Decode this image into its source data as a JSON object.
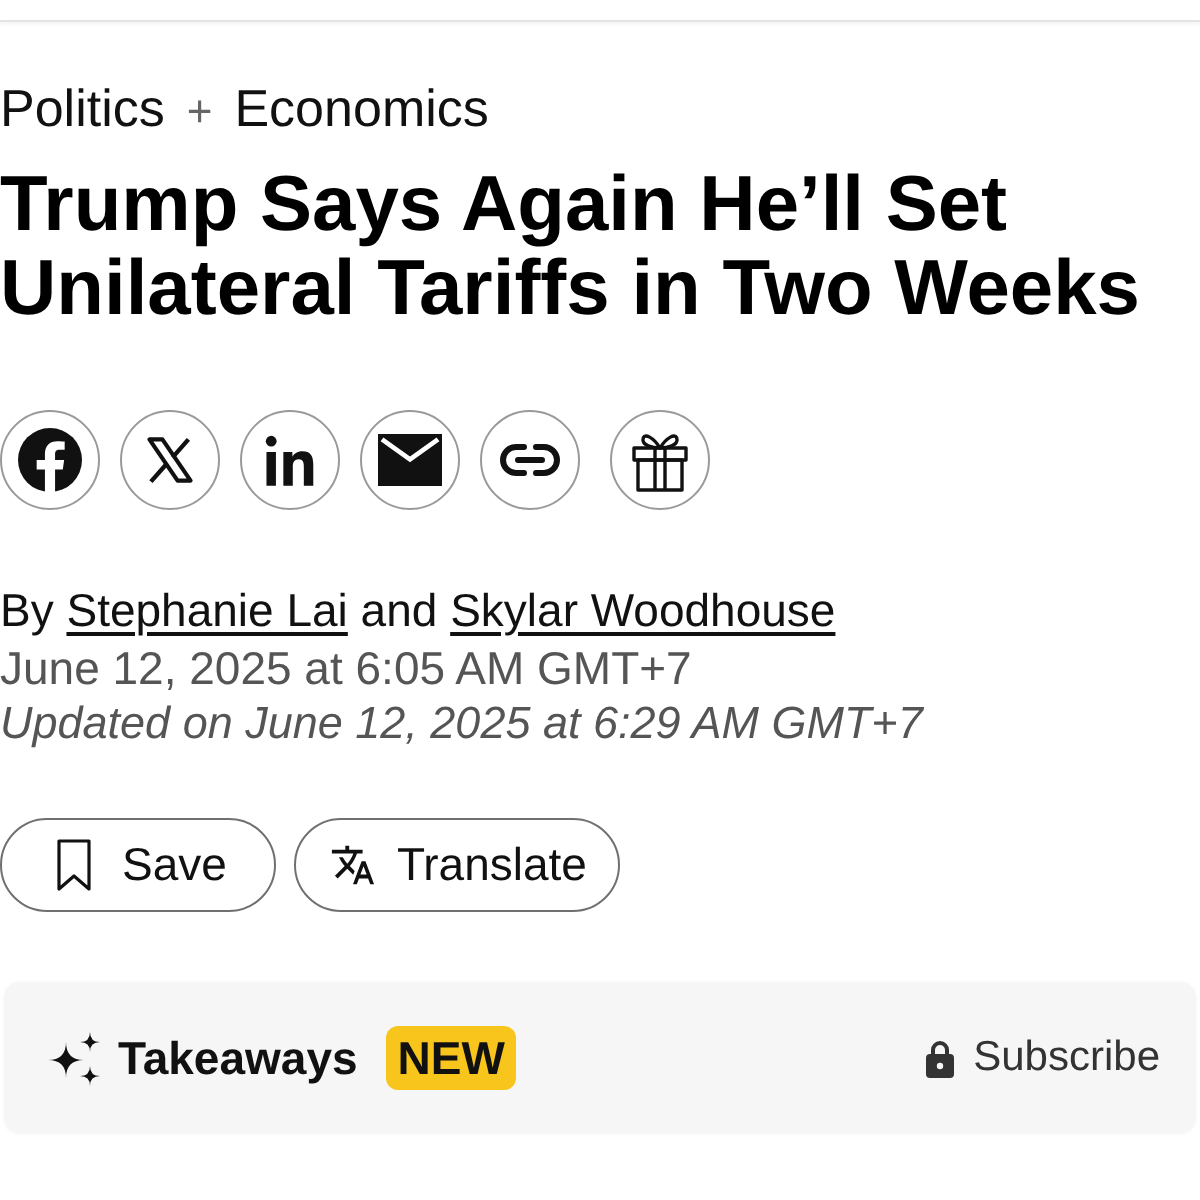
{
  "kicker": {
    "topics": [
      {
        "label": "Politics"
      },
      {
        "label": "Economics"
      }
    ],
    "separator": "+"
  },
  "headline": "Trump Says Again He’ll Set Unilateral Tariffs in Two Weeks",
  "share_buttons": [
    {
      "kind": "facebook"
    },
    {
      "kind": "x"
    },
    {
      "kind": "linkedin"
    },
    {
      "kind": "email"
    },
    {
      "kind": "link"
    },
    {
      "kind": "gift"
    }
  ],
  "byline": {
    "prefix": "By",
    "authors": [
      "Stephanie Lai",
      "Skylar Woodhouse"
    ],
    "conjunction": "and"
  },
  "published": "June 12, 2025 at 6:05 AM GMT+7",
  "updated": "Updated on June 12, 2025 at 6:29 AM GMT+7",
  "actions": [
    {
      "kind": "save",
      "label": "Save"
    },
    {
      "kind": "translate",
      "label": "Translate"
    }
  ],
  "takeaways": {
    "label": "Takeaways",
    "badge": "NEW",
    "subscribe": "Subscribe"
  }
}
